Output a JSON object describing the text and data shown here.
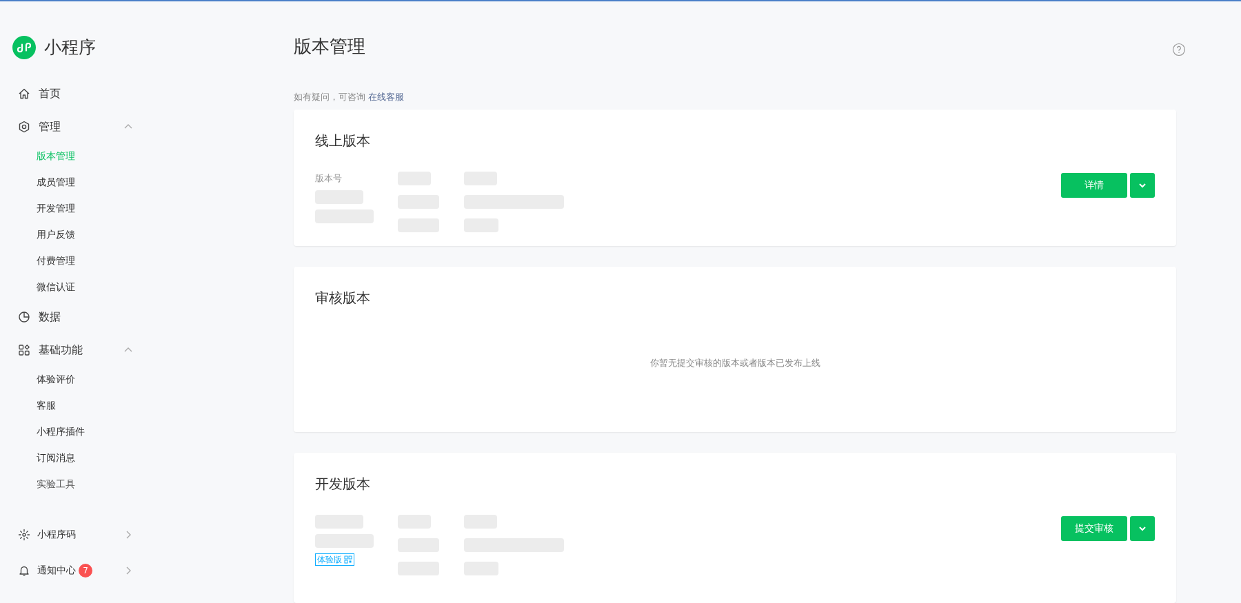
{
  "sidebar": {
    "app_name": "小程序",
    "items": [
      {
        "kind": "home",
        "label": "首页",
        "selected": false
      },
      {
        "kind": "manage",
        "label": "管理",
        "expanded": true,
        "children": [
          {
            "label": "版本管理",
            "selected": true
          },
          {
            "label": "成员管理",
            "selected": false
          },
          {
            "label": "开发管理",
            "selected": false
          },
          {
            "label": "用户反馈",
            "selected": false
          },
          {
            "label": "付费管理",
            "selected": false
          },
          {
            "label": "微信认证",
            "selected": false
          }
        ]
      },
      {
        "kind": "data",
        "label": "数据",
        "selected": false
      },
      {
        "kind": "features",
        "label": "基础功能",
        "expanded": true,
        "children": [
          {
            "label": "体验评价",
            "selected": false
          },
          {
            "label": "客服",
            "selected": false
          },
          {
            "label": "小程序插件",
            "selected": false
          },
          {
            "label": "订阅消息",
            "selected": false
          },
          {
            "label": "实验工具",
            "selected": false
          }
        ]
      }
    ],
    "bottom": [
      {
        "kind": "code",
        "label": "小程序码"
      },
      {
        "kind": "bell",
        "label": "通知中心",
        "badge": "7"
      }
    ]
  },
  "page": {
    "title": "版本管理",
    "hint": "如有疑问，可咨询",
    "hint_link": "在线客服"
  },
  "cards": [
    {
      "kind": "version",
      "title": "线上版本",
      "field_label": "版本号",
      "button": "详情"
    },
    {
      "kind": "empty",
      "title": "审核版本",
      "message": "你暂无提交审核的版本或者版本已发布上线"
    },
    {
      "kind": "version",
      "title": "开发版本",
      "button": "提交审核",
      "tag": "体验版"
    }
  ]
}
